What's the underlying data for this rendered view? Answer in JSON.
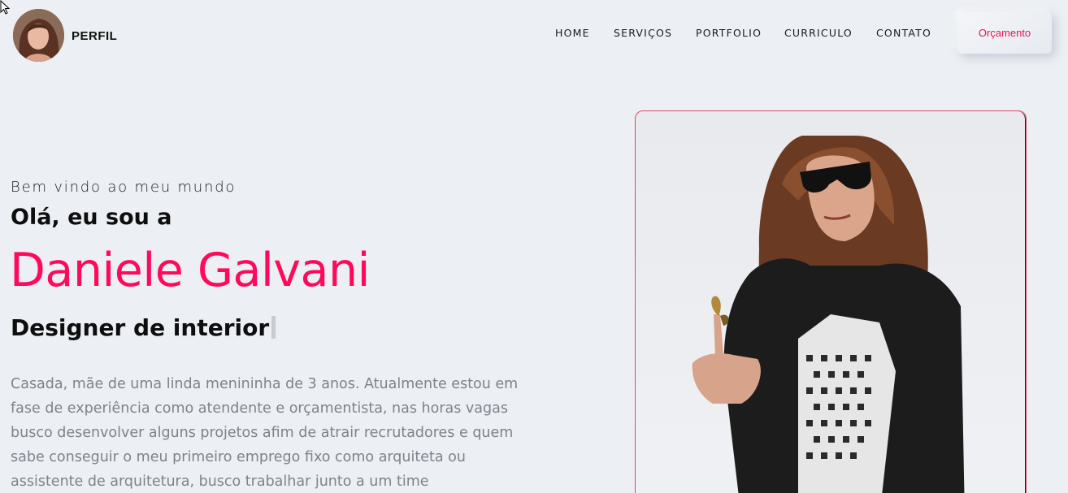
{
  "header": {
    "brand": "PERFIL",
    "nav": [
      "HOME",
      "SERVIÇOS",
      "PORTFOLIO",
      "CURRICULO",
      "CONTATO"
    ],
    "quote_button": "Orçamento"
  },
  "hero": {
    "welcome": "Bem vindo ao meu mundo",
    "hello": "Olá, eu sou a",
    "name": "Daniele Galvani",
    "role": "Designer de interior",
    "bio": "Casada, mãe de uma linda menininha de 3 anos. Atualmente estou em fase de experiência como atendente e orçamentista, nas horas vagas busco desenvolver alguns projetos afim de atrair recrutadores e quem sabe conseguir o meu primeiro emprego fixo como arquiteta ou assistente de arquitetura, busco trabalhar junto a um time"
  },
  "colors": {
    "accent": "#ff0a5a",
    "background": "#eceff3"
  }
}
